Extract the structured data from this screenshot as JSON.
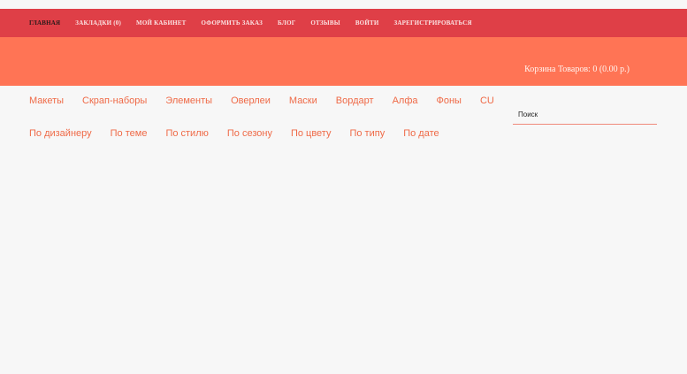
{
  "top_nav": {
    "items": [
      {
        "label": "ГЛАВНАЯ"
      },
      {
        "label": "ЗАКЛАДКИ (0)"
      },
      {
        "label": "МОЙ КАБИНЕТ"
      },
      {
        "label": "ОФОРМИТЬ ЗАКАЗ"
      },
      {
        "label": "БЛОГ"
      },
      {
        "label": "ОТЗЫВЫ"
      },
      {
        "label": "ВОЙТИ"
      },
      {
        "label": "ЗАРЕГИСТРИРОВАТЬСЯ"
      }
    ],
    "active_index": 0
  },
  "header": {
    "cart_text": "Корзина Товаров: 0 (0.00 р.)"
  },
  "categories": {
    "row1": [
      {
        "label": "Макеты"
      },
      {
        "label": "Скрап-наборы"
      },
      {
        "label": "Элементы"
      },
      {
        "label": "Оверлеи"
      },
      {
        "label": "Маски"
      },
      {
        "label": "Вордарт"
      },
      {
        "label": "Алфа"
      },
      {
        "label": "Фоны"
      },
      {
        "label": "CU"
      }
    ],
    "row2": [
      {
        "label": "По дизайнеру"
      },
      {
        "label": "По теме"
      },
      {
        "label": "По стилю"
      },
      {
        "label": "По сезону"
      },
      {
        "label": "По цвету"
      },
      {
        "label": "По типу"
      },
      {
        "label": "По дате"
      }
    ]
  },
  "search": {
    "placeholder": "Поиск",
    "value": ""
  },
  "colors": {
    "nav_bg": "#df3f47",
    "header_bg": "#ff7455",
    "link": "#ef6a47",
    "page_bg": "#f7f7f7"
  }
}
